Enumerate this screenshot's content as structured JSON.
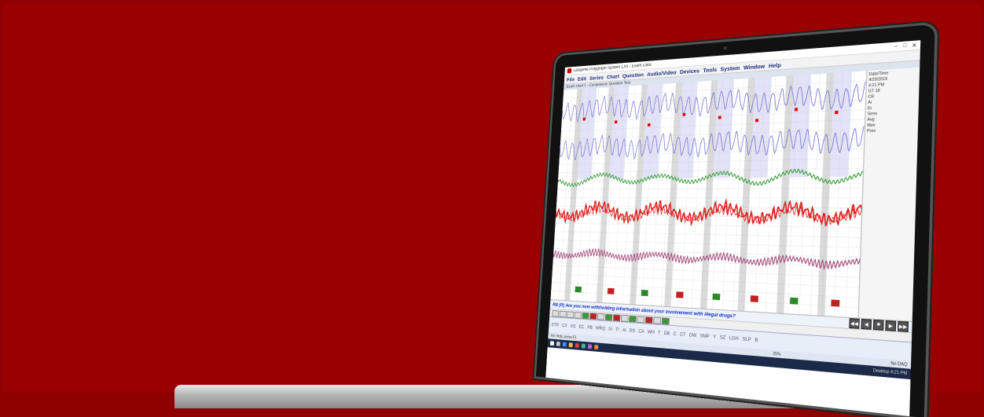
{
  "window": {
    "title": "Lafayette Polygraph System LX5 - Exam Data",
    "controls": [
      "–",
      "□",
      "✕"
    ]
  },
  "menu": [
    "File",
    "Edit",
    "Series",
    "Chart",
    "Question",
    "Audio/Video",
    "Devices",
    "Tools",
    "System",
    "Window",
    "Help"
  ],
  "doc_tab": "Exam chart 1 - Comparison Question Test",
  "right_panel": [
    "Date/Time",
    "4/29/2016",
    "4:21 PM",
    "GT 18",
    "CR",
    "Ar",
    "Er",
    "Sens",
    "Avg",
    "Max",
    "Pres"
  ],
  "question": "R8 (R) Are you now withholding information about your involvement with illegal drugs?",
  "nav_buttons": [
    "◀◀",
    "◀",
    "■",
    "▶",
    "▶▶"
  ],
  "sequence": [
    {
      "label": "",
      "state": "none"
    },
    {
      "label": "",
      "state": "none"
    },
    {
      "label": "",
      "state": "none"
    },
    {
      "label": "",
      "state": "none"
    },
    {
      "label": "",
      "state": "green"
    },
    {
      "label": "",
      "state": "red"
    },
    {
      "label": "",
      "state": "none"
    },
    {
      "label": "",
      "state": "green"
    },
    {
      "label": "",
      "state": "red"
    },
    {
      "label": "",
      "state": "none"
    },
    {
      "label": "",
      "state": "green"
    },
    {
      "label": "",
      "state": "none"
    },
    {
      "label": "",
      "state": "red"
    },
    {
      "label": "",
      "state": "none"
    },
    {
      "label": "",
      "state": "green"
    }
  ],
  "labels": [
    "STR",
    "CX",
    "XO",
    "EC",
    "PB",
    "WRQ",
    "SI",
    "TI",
    "AI",
    "RS",
    "CA",
    "WH",
    "T",
    "DB",
    "C",
    "CT",
    "DW",
    "SMP",
    "Y",
    "SZ",
    "LGH",
    "SLP",
    "B"
  ],
  "status": {
    "left": "For Help, press F1",
    "mid": "25%",
    "right": "No DAQ"
  },
  "tray": "Desktop  4:21 PM",
  "colors": {
    "background": "#990000",
    "pneumo": "#7070d8",
    "eda": "#2a9a2a",
    "cardio": "#e02020",
    "activity": "#a04070"
  },
  "icons": {
    "app": "polygraph-app-icon",
    "taskbar": [
      "windows-start-icon",
      "search-icon",
      "browser-icon",
      "folder-icon",
      "mail-icon",
      "store-icon",
      "app-icon",
      "app-icon"
    ]
  }
}
